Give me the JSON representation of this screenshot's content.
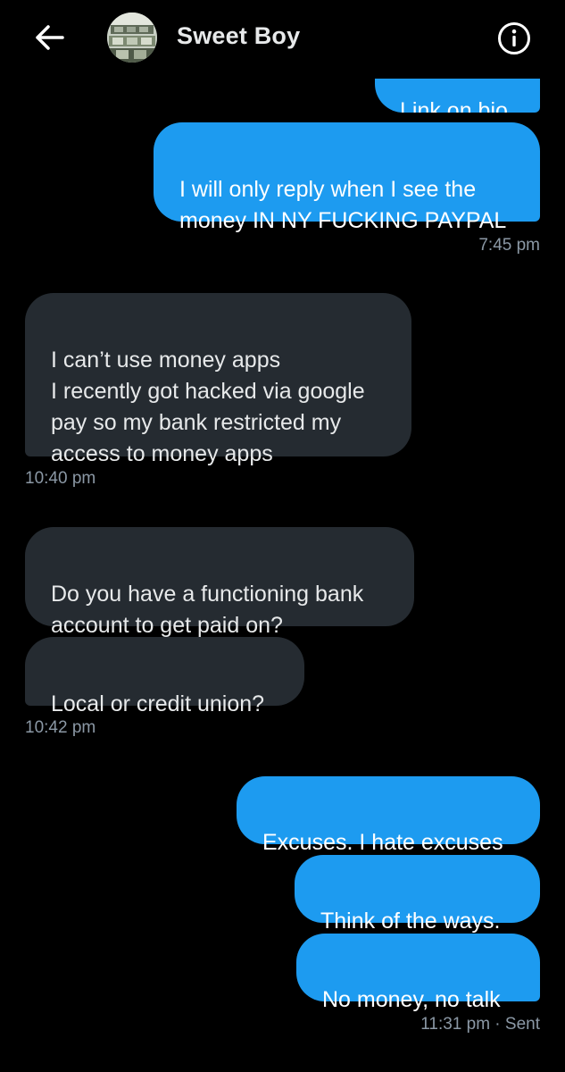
{
  "header": {
    "title": "Sweet Boy"
  },
  "messages": {
    "m0": "Link on bio",
    "m1": "I will only reply when I see the\nmoney IN NY FUCKING PAYPAL",
    "t1": "7:45 pm",
    "m2": "I can’t use money apps\nI recently got hacked via google\npay so my bank restricted my\naccess to money apps",
    "t2": "10:40 pm",
    "m3": "Do you have a functioning bank\naccount to get paid on?",
    "m4": "Local or credit union?",
    "t3": "10:42 pm",
    "m5": "Excuses. I hate excuses",
    "m6": "Think of the ways.",
    "m7": "No money, no talk",
    "t4": "11:31 pm · Sent"
  },
  "colors": {
    "outgoing_bubble": "#1d9bf0",
    "incoming_bubble": "#252b31",
    "background": "#000000",
    "timestamp": "#8b98a5"
  },
  "icons": {
    "back": "arrow-left-icon",
    "info": "info-circle-icon"
  }
}
